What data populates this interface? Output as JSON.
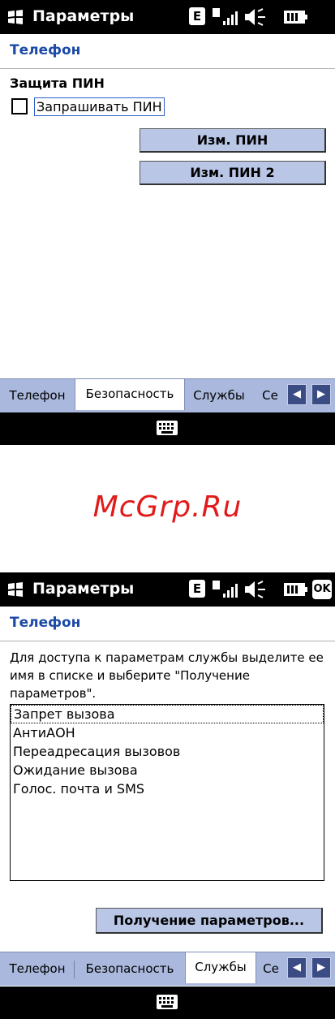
{
  "screens": [
    {
      "status": {
        "title": "Параметры",
        "network_icon_label": "E",
        "ok_label": ""
      },
      "heading": "Телефон",
      "pin_group_title": "Защита ПИН",
      "ask_pin_checkbox": {
        "label": "Запрашивать ПИН",
        "checked": false
      },
      "buttons": {
        "change_pin": "Изм. ПИН",
        "change_pin2": "Изм. ПИН 2"
      },
      "tabs": [
        {
          "label": "Телефон",
          "active": false
        },
        {
          "label": "Безопасность",
          "active": true
        },
        {
          "label": "Службы",
          "active": false
        },
        {
          "label": "Се",
          "active": false
        }
      ]
    },
    {
      "status": {
        "title": "Параметры",
        "network_icon_label": "E",
        "ok_label": "OK"
      },
      "heading": "Телефон",
      "description": "Для доступа к параметрам службы выделите ее имя в списке и выберите \"Получение параметров\".",
      "services": [
        "Запрет вызова",
        "АнтиАОН",
        "Переадресация вызовов",
        "Ожидание вызова",
        "Голос. почта и SMS"
      ],
      "get_params_button": "Получение параметров...",
      "tabs": [
        {
          "label": "Телефон",
          "active": false
        },
        {
          "label": "Безопасность",
          "active": false
        },
        {
          "label": "Службы",
          "active": true
        },
        {
          "label": "Се",
          "active": false
        }
      ]
    }
  ],
  "watermark": "McGrp.Ru",
  "colors": {
    "heading": "#1c4aa6",
    "tabbar": "#a9b8dc",
    "button": "#b9c6e6",
    "watermark": "#e11a1a"
  }
}
